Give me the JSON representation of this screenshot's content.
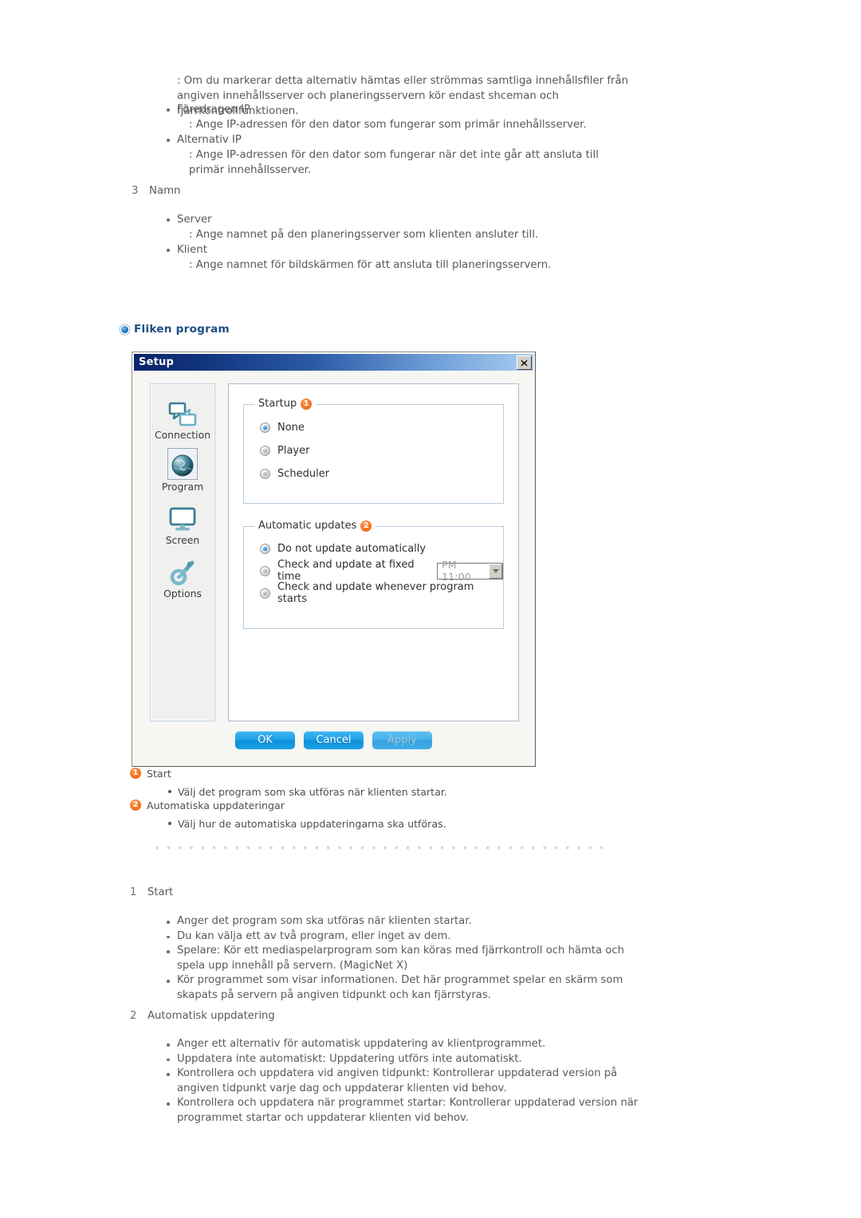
{
  "top_section": {
    "intro_lines": [
      ": Om du markerar detta alternativ hämtas eller strömmas samtliga innehållsfiler från angiven innehållsserver och planeringsservern kör endast shceman och fjärrkontrollfunktionen."
    ],
    "bullets": [
      {
        "term": "Föredragen IP",
        "desc": ": Ange IP-adressen för den dator som fungerar som primär innehållsserver."
      },
      {
        "term": "Alternativ IP",
        "desc": ": Ange IP-adressen för den dator som fungerar när det inte går att ansluta till primär innehållsserver."
      }
    ]
  },
  "section_namn": {
    "number": "3",
    "title": "Namn",
    "bullets": [
      {
        "term": "Server",
        "desc": ": Ange namnet på den planeringsserver som klienten ansluter till."
      },
      {
        "term": "Klient",
        "desc": ": Ange namnet för bildskärmen för att ansluta till planeringsservern."
      }
    ]
  },
  "heading": {
    "text": "Fliken program"
  },
  "dialog": {
    "title": "Setup",
    "close_label": "×",
    "sidebar": [
      {
        "label": "Connection",
        "icon": "connection-icon",
        "selected": false
      },
      {
        "label": "Program",
        "icon": "globe-icon",
        "selected": true
      },
      {
        "label": "Screen",
        "icon": "monitor-icon",
        "selected": false
      },
      {
        "label": "Options",
        "icon": "wrench-icon",
        "selected": false
      }
    ],
    "groups": [
      {
        "label": "Startup",
        "badge": "1",
        "options": [
          {
            "label": "None",
            "selected": true
          },
          {
            "label": "Player",
            "selected": false
          },
          {
            "label": "Scheduler",
            "selected": false
          }
        ]
      },
      {
        "label": "Automatic updates",
        "badge": "2",
        "options": [
          {
            "label": "Do not update automatically",
            "selected": true
          },
          {
            "label": "Check and update at fixed time",
            "selected": false
          },
          {
            "label": "Check and update whenever program starts",
            "selected": false
          }
        ],
        "time_value": "PM 11:00"
      }
    ],
    "buttons": [
      {
        "label": "OK",
        "disabled": false
      },
      {
        "label": "Cancel",
        "disabled": false
      },
      {
        "label": "Apply",
        "disabled": true
      }
    ]
  },
  "legend": [
    {
      "badge": "1",
      "title": "Start",
      "sub": "Välj det program som ska utföras när klienten startar."
    },
    {
      "badge": "2",
      "title": "Automatiska uppdateringar",
      "sub": "Välj hur de automatiska uppdateringarna ska utföras."
    }
  ],
  "bottom": {
    "item1": {
      "number": "1",
      "title": "Start",
      "bullets": [
        "Anger det program som ska utföras när klienten startar.",
        "Du kan välja ett av två program, eller inget av dem.",
        "Spelare: Kör ett mediaspelarprogram som kan köras med fjärrkontroll och hämta och spela upp innehåll på servern. (MagicNet X)",
        "Kör programmet som visar informationen. Det här programmet spelar en skärm som skapats på servern på angiven tidpunkt och kan fjärrstyras."
      ]
    },
    "item2": {
      "number": "2",
      "title": "Automatisk uppdatering",
      "bullets": [
        "Anger ett alternativ för automatisk uppdatering av klientprogrammet.",
        "Uppdatera inte automatiskt: Uppdatering utförs inte automatiskt.",
        "Kontrollera och uppdatera vid angiven tidpunkt: Kontrollerar uppdaterad version på angiven tidpunkt varje dag och uppdaterar klienten vid behov.",
        "Kontrollera och uppdatera när programmet startar: Kontrollerar uppdaterad version när programmet startar och uppdaterar klienten vid behov."
      ]
    }
  },
  "colors": {
    "accent_blue": "#1b4e84",
    "badge_orange": "#f4711f",
    "titlebar_dark": "#0a246a",
    "titlebar_light": "#a9cdf0"
  }
}
